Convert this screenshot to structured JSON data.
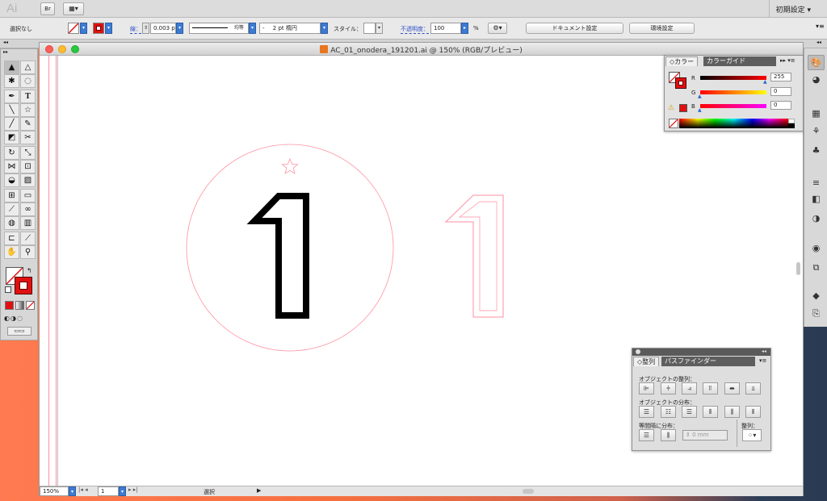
{
  "app": {
    "logo": "Ai",
    "workspace": "初期設定 ▾"
  },
  "control_bar": {
    "selection_status": "選択なし",
    "stroke_label": "線：",
    "stroke_weight": "0.003 p",
    "profile": "均等",
    "brush": "2 pt 楕円",
    "brush_prefix": "-",
    "style_label": "スタイル：",
    "opacity_label": "不透明度：",
    "opacity_value": "100",
    "percent": "%",
    "document_setup": "ドキュメント設定",
    "preferences": "環境設定"
  },
  "document": {
    "title": "AC_01_onodera_191201.ai @ 150% (RGB/プレビュー)",
    "zoom": "150%",
    "artboard": "1",
    "status": "選択"
  },
  "color_panel": {
    "tab_color": "カラー",
    "tab_guide": "カラーガイド",
    "r_label": "R",
    "g_label": "G",
    "b_label": "B",
    "r_value": "255",
    "g_value": "0",
    "b_value": "0",
    "fill_color": "#e01010"
  },
  "align_panel": {
    "tab_align": "整列",
    "tab_pathfinder": "パスファインダー",
    "align_objects": "オブジェクトの整列：",
    "distribute_objects": "オブジェクトの分布：",
    "distribute_spacing": "等間隔に分布：",
    "align_to": "整列：",
    "spacing_value": "0 mm"
  },
  "artwork": {
    "glyph": "1",
    "guide_color": "#ff8fa0"
  }
}
